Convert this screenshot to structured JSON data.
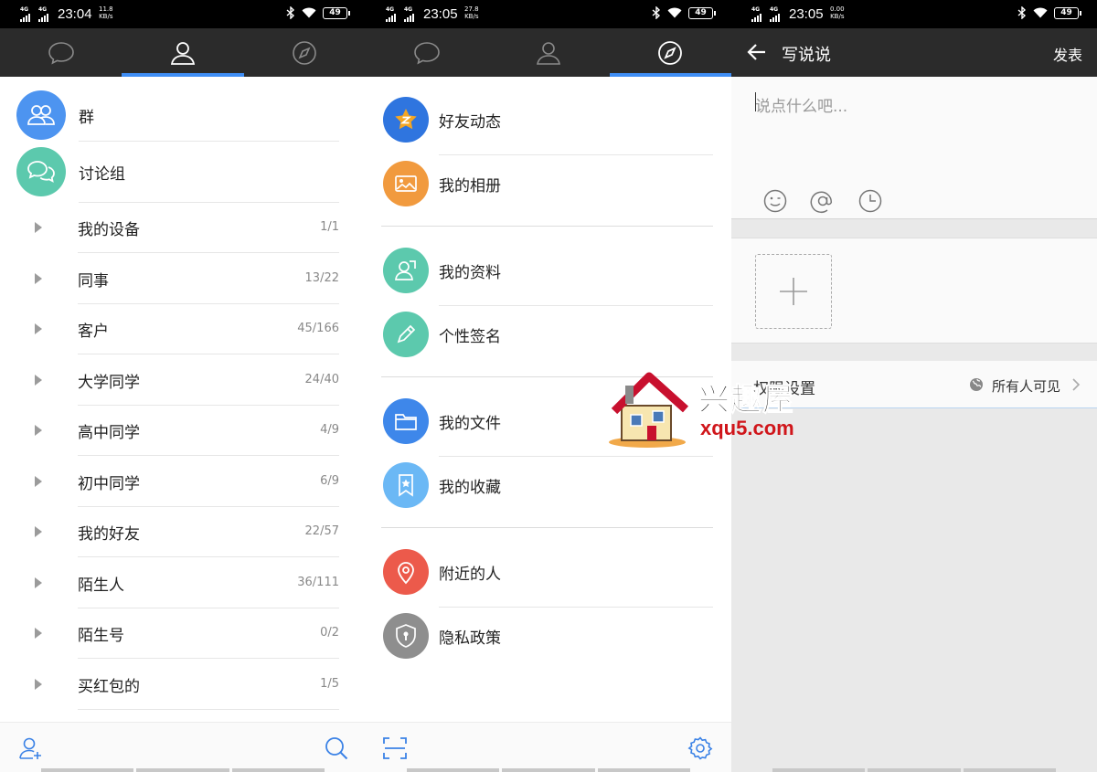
{
  "screens": [
    {
      "status": {
        "net1": "4G",
        "net2": "4G",
        "time": "23:04",
        "speed": "11.8",
        "speed_unit": "KB/s",
        "battery": "49"
      },
      "tabs": [
        {
          "icon": "chat-bubble-icon"
        },
        {
          "icon": "contacts-icon",
          "active": true
        },
        {
          "icon": "compass-icon"
        }
      ],
      "groups": [
        {
          "label": "群",
          "color": "#4d94f0"
        },
        {
          "label": "讨论组",
          "color": "#5cc9ad"
        }
      ],
      "friends": [
        {
          "name": "我的设备",
          "count": "1/1"
        },
        {
          "name": "同事",
          "count": "13/22"
        },
        {
          "name": "客户",
          "count": "45/166"
        },
        {
          "name": "大学同学",
          "count": "24/40"
        },
        {
          "name": "高中同学",
          "count": "4/9"
        },
        {
          "name": "初中同学",
          "count": "6/9"
        },
        {
          "name": "我的好友",
          "count": "22/57"
        },
        {
          "name": "陌生人",
          "count": "36/111"
        },
        {
          "name": "陌生号",
          "count": "0/2"
        },
        {
          "name": "买红包的",
          "count": "1/5"
        }
      ]
    },
    {
      "status": {
        "net1": "4G",
        "net2": "4G",
        "time": "23:05",
        "speed": "27.8",
        "speed_unit": "KB/s",
        "battery": "49"
      },
      "menu": [
        {
          "label": "好友动态",
          "color": "#2f75df",
          "icon": "qzone-star-icon"
        },
        {
          "label": "我的相册",
          "color": "#f19a3e",
          "icon": "photo-album-icon"
        },
        {
          "label": "我的资料",
          "color": "#5cc9ad",
          "icon": "profile-card-icon"
        },
        {
          "label": "个性签名",
          "color": "#5cc9ad",
          "icon": "pencil-icon"
        },
        {
          "label": "我的文件",
          "color": "#3e87ea",
          "icon": "folder-icon"
        },
        {
          "label": "我的收藏",
          "color": "#6bb8f5",
          "icon": "bookmark-star-icon"
        },
        {
          "label": "附近的人",
          "color": "#ec5a4b",
          "icon": "location-pin-icon"
        },
        {
          "label": "隐私政策",
          "color": "#8e8e8e",
          "icon": "shield-keyhole-icon"
        }
      ]
    },
    {
      "status": {
        "net1": "4G",
        "net2": "4G",
        "time": "23:05",
        "speed": "0.00",
        "speed_unit": "KB/s",
        "battery": "49"
      },
      "title": "写说说",
      "publish": "发表",
      "placeholder": "说点什么吧...",
      "privacy_label": "权限设置",
      "privacy_value": "所有人可见"
    }
  ],
  "watermark": {
    "cn": "兴趣屋",
    "en": "xqu5.com"
  }
}
